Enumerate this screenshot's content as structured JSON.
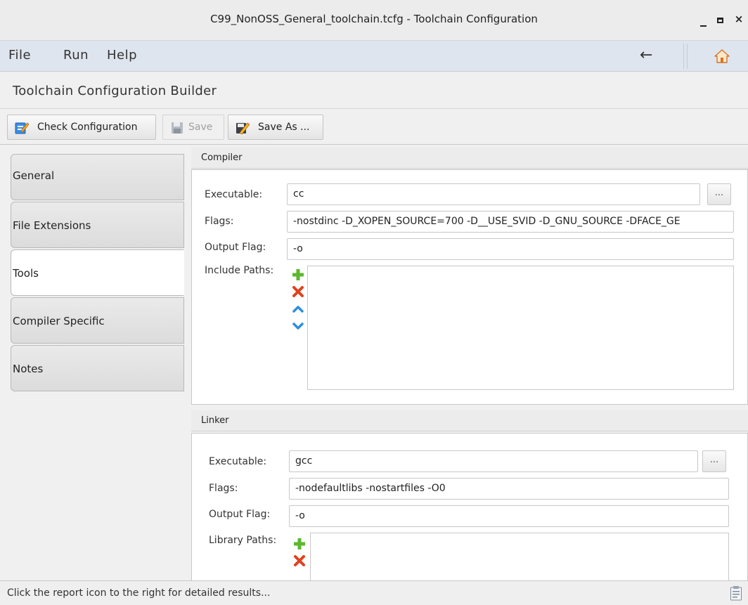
{
  "window": {
    "title": "C99_NonOSS_General_toolchain.tcfg - Toolchain Configuration",
    "close_label": "×"
  },
  "menu": {
    "file": "File",
    "run": "Run",
    "help": "Help",
    "back_arrow": "←"
  },
  "builder": {
    "title": "Toolchain Configuration Builder"
  },
  "toolbar": {
    "check_label": "Check Configuration",
    "save_label": "Save",
    "save_disabled": true,
    "save_as_label": "Save As ..."
  },
  "tabs": [
    {
      "label": "General",
      "active": false
    },
    {
      "label": "File Extensions",
      "active": false
    },
    {
      "label": "Tools",
      "active": true
    },
    {
      "label": "Compiler Specific",
      "active": false
    },
    {
      "label": "Notes",
      "active": false
    }
  ],
  "compiler": {
    "header": "Compiler",
    "executable_label": "Executable:",
    "executable_value": "cc",
    "browse_label": "...",
    "flags_label": "Flags:",
    "flags_value": "-nostdinc -D_XOPEN_SOURCE=700 -D__USE_SVID -D_GNU_SOURCE -DFACE_GE",
    "output_flag_label": "Output Flag:",
    "output_flag_value": "-o",
    "include_paths_label": "Include Paths:"
  },
  "linker": {
    "header": "Linker",
    "executable_label": "Executable:",
    "executable_value": "gcc",
    "browse_label": "...",
    "flags_label": "Flags:",
    "flags_value": "-nodefaultlibs -nostartfiles -O0",
    "output_flag_label": "Output Flag:",
    "output_flag_value": "-o",
    "library_paths_label": "Library Paths:"
  },
  "status": {
    "message": "Click the report icon to the right for detailed results..."
  },
  "colors": {
    "menubar": "#dfe5ee",
    "add": "#5cb82e",
    "remove": "#e2401c",
    "move": "#2d8fe0",
    "home": "#e58a3a"
  },
  "icons": {
    "back": "arrow-left-icon",
    "home": "home-icon",
    "check": "check-configuration-icon",
    "save": "floppy-disk-icon",
    "save_as": "save-as-icon",
    "add": "plus-icon",
    "remove": "x-icon",
    "up": "chevron-up-icon",
    "down": "chevron-down-icon",
    "report": "report-icon"
  }
}
